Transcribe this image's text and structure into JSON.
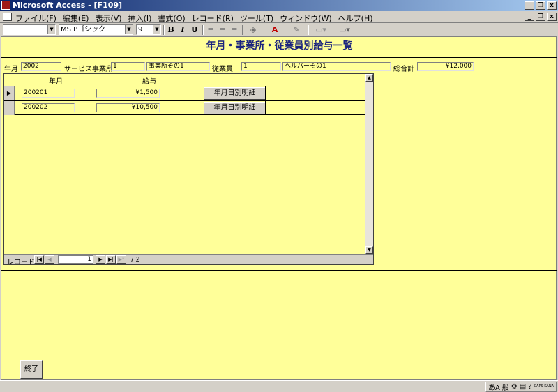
{
  "window": {
    "title": "Microsoft Access - [F109]"
  },
  "window_buttons": {
    "minimize": "_",
    "restore": "❐",
    "close": "x"
  },
  "menu": {
    "items": [
      "ファイル(F)",
      "編集(E)",
      "表示(V)",
      "挿入(I)",
      "書式(O)",
      "レコード(R)",
      "ツール(T)",
      "ウィンドウ(W)",
      "ヘルプ(H)"
    ]
  },
  "toolbar": {
    "object_combo": "",
    "font_name": "MS Pゴシック",
    "font_size": "9",
    "bold": "B",
    "italic": "I",
    "underline": "U",
    "font_color_glyph": "A",
    "fill_glyph": "◈",
    "line_glyph": "✎"
  },
  "form": {
    "title": "年月・事業所・従業員別給与一覧",
    "header": {
      "year_month_label": "年月",
      "year_month_value": "2002",
      "office_label": "サービス事業所",
      "office_id": "1",
      "office_name": "事業所その1",
      "employee_label": "従業員",
      "employee_id": "1",
      "employee_name": "ヘルパーその1",
      "total_label": "総合計",
      "total_value": "¥12,000"
    },
    "subform": {
      "columns": {
        "year_month": "年月",
        "salary": "給与"
      },
      "rows": [
        {
          "year_month": "200201",
          "salary": "¥1,500",
          "button": "年月日別明細",
          "selector": "▶"
        },
        {
          "year_month": "200202",
          "salary": "¥10,500",
          "button": "年月日別明細",
          "selector": ""
        }
      ],
      "nav": {
        "label": "レコード:",
        "current": "1",
        "total": "/ 2",
        "first": "|◀",
        "prev": "◀",
        "next": "▶",
        "last": "▶|",
        "new": "▶*"
      }
    },
    "end_button": "終了"
  },
  "status_bar": {
    "ime_mode": "般",
    "caps": "CAPS KANA"
  }
}
